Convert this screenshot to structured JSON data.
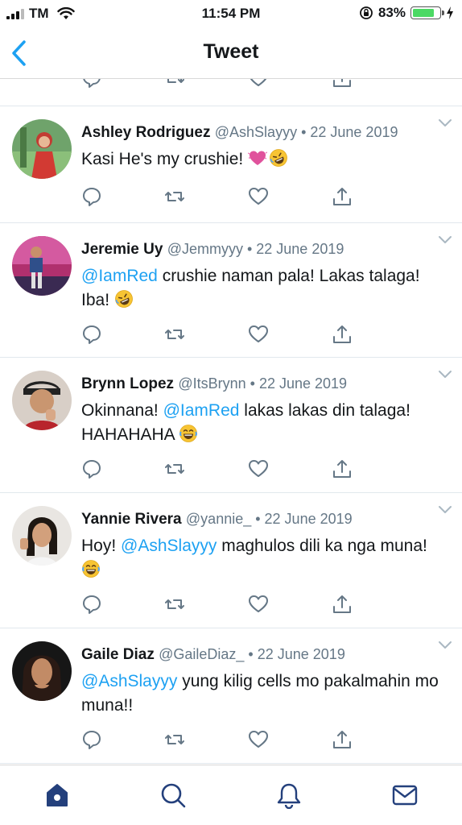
{
  "status_bar": {
    "carrier": "TM",
    "time": "11:54 PM",
    "battery_percent": "83%",
    "battery_level": 0.83,
    "icons": [
      "signal-icon",
      "wifi-icon",
      "orientation-lock-icon",
      "battery-icon",
      "charging-bolt-icon"
    ]
  },
  "nav": {
    "title": "Tweet",
    "back_icon": "chevron-left-icon"
  },
  "colors": {
    "accent": "#1da1f2",
    "nav_accent": "#1da1f2",
    "text": "#14171a",
    "muted": "#657786",
    "tab_active": "#24407c",
    "divider": "#e1e8ed"
  },
  "tweets": [
    {
      "author": "Ashley Rodriguez",
      "meta": "@AshSlayyy • 22 June 2019",
      "text_parts": [
        {
          "type": "text",
          "value": "Kasi He's my crushie! "
        }
      ],
      "emojis": [
        "sparkling-heart-emoji",
        "rofl-emoji"
      ]
    },
    {
      "author": "Jeremie Uy",
      "meta": "@Jemmyyy • 22 June 2019",
      "text_parts": [
        {
          "type": "mention",
          "value": "@IamRed"
        },
        {
          "type": "text",
          "value": " crushie naman pala! Lakas talaga! Iba! "
        }
      ],
      "emojis": [
        "rofl-emoji"
      ]
    },
    {
      "author": "Brynn Lopez",
      "meta": "@ItsBrynn • 22 June 2019",
      "text_parts": [
        {
          "type": "text",
          "value": "Okinnana! "
        },
        {
          "type": "mention",
          "value": "@IamRed"
        },
        {
          "type": "text",
          "value": " lakas lakas din talaga! HAHAHAHA "
        }
      ],
      "emojis": [
        "joy-emoji"
      ]
    },
    {
      "author": "Yannie Rivera",
      "meta": "@yannie_ • 22 June 2019",
      "text_parts": [
        {
          "type": "text",
          "value": "Hoy! "
        },
        {
          "type": "mention",
          "value": "@AshSlayyy"
        },
        {
          "type": "text",
          "value": " maghulos dili ka nga muna! "
        }
      ],
      "emojis": [
        "joy-emoji"
      ]
    },
    {
      "author": "Gaile Diaz",
      "meta": "@GaileDiaz_ • 22 June 2019",
      "text_parts": [
        {
          "type": "mention",
          "value": "@AshSlayyy"
        },
        {
          "type": "text",
          "value": " yung kilig cells mo pakalmahin mo muna!!"
        }
      ],
      "emojis": []
    }
  ],
  "action_icons": [
    "reply-icon",
    "retweet-icon",
    "like-icon",
    "share-icon"
  ],
  "tab_bar": [
    "home-icon",
    "search-icon",
    "notifications-icon",
    "messages-icon"
  ]
}
